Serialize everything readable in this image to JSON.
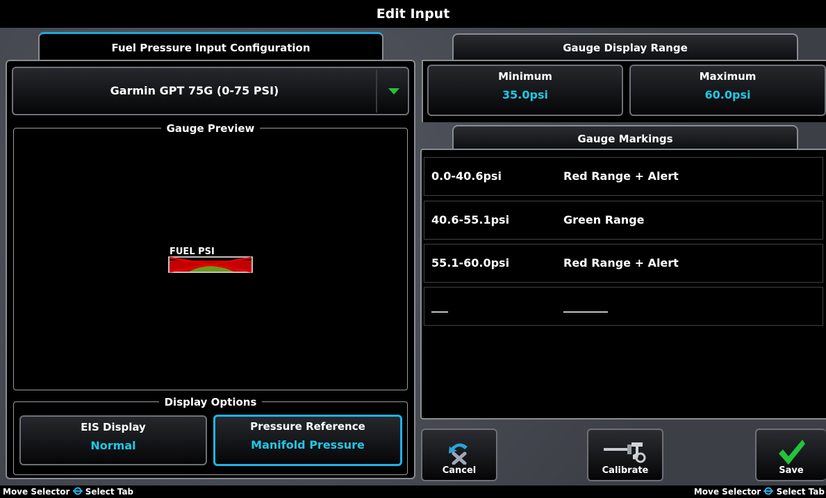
{
  "window": {
    "title": "Edit Input"
  },
  "tabs": {
    "left": "Fuel Pressure Input Configuration",
    "range": "Gauge Display Range",
    "markings": "Gauge Markings"
  },
  "sensor_dropdown": {
    "selected": "Garmin GPT 75G (0-75 PSI)",
    "icon": "triangle-down-icon",
    "icon_color": "#22c33a"
  },
  "gauge_preview": {
    "title": "Gauge Preview",
    "gauge_label": "FUEL PSI",
    "colors": {
      "red": "#e00000",
      "green": "#22c33a"
    }
  },
  "display_options": {
    "title": "Display Options",
    "eis_display": {
      "label": "EIS Display",
      "value": "Normal"
    },
    "pressure_reference": {
      "label": "Pressure Reference",
      "value": "Manifold Pressure"
    }
  },
  "range": {
    "minimum": {
      "label": "Minimum",
      "value": "35.0psi"
    },
    "maximum": {
      "label": "Maximum",
      "value": "60.0psi"
    }
  },
  "markings": [
    {
      "range": "0.0-40.6psi",
      "type": "Red Range + Alert"
    },
    {
      "range": "40.6-55.1psi",
      "type": "Green Range"
    },
    {
      "range": "55.1-60.0psi",
      "type": "Red Range + Alert"
    },
    {
      "range": "___",
      "type": "________"
    }
  ],
  "softkeys": {
    "cancel": {
      "label": "Cancel",
      "icon": "cancel-undo-icon"
    },
    "calibrate": {
      "label": "Calibrate",
      "icon": "calibrate-icon"
    },
    "save": {
      "label": "Save",
      "icon": "checkmark-icon",
      "icon_color": "#22c33a"
    }
  },
  "status_bar": {
    "left": {
      "move": "Move Selector",
      "select": "Select Tab"
    },
    "right": {
      "move": "Move Selector",
      "select": "Select Tab"
    }
  },
  "accent_color": "#1ec8e8"
}
